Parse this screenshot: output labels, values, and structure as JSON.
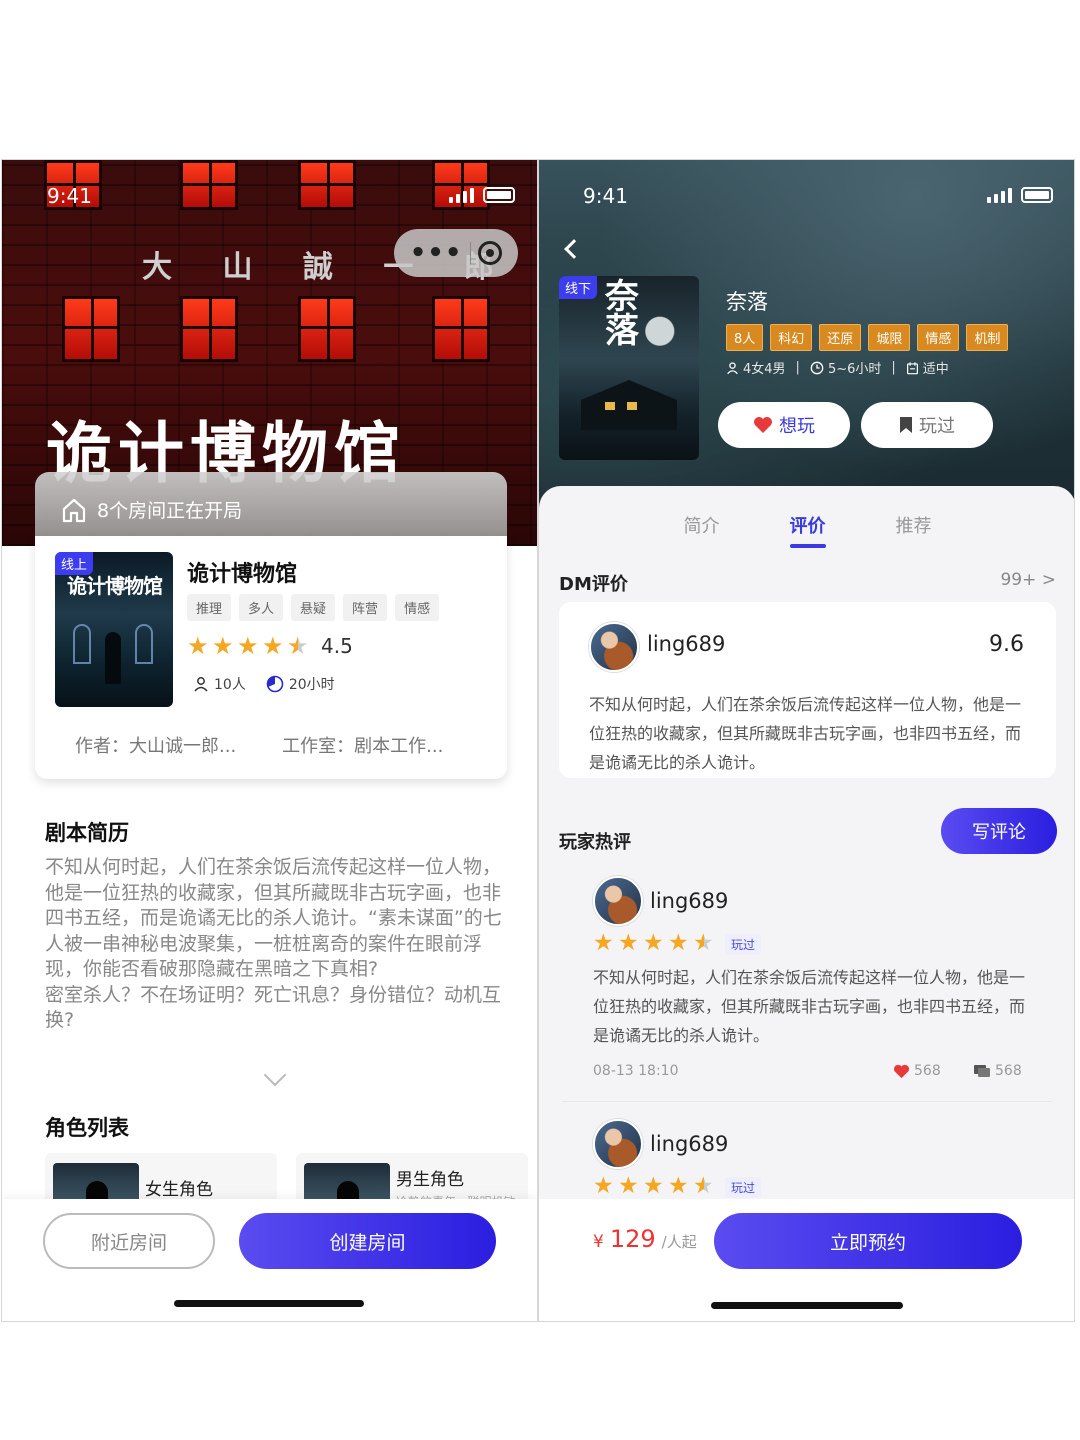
{
  "left": {
    "status": {
      "time": "9:41"
    },
    "hero": {
      "author_banner": "大 山 誠 一 郎",
      "title": "诡计博物馆"
    },
    "rooms_bar": {
      "text": "8个房间正在开局"
    },
    "game": {
      "cover_tag": "线上",
      "cover_title": "诡计博物馆",
      "name": "诡计博物馆",
      "tags": [
        "推理",
        "多人",
        "悬疑",
        "阵营",
        "情感"
      ],
      "rating": "4.5",
      "rating_value": 4.5,
      "players": "10人",
      "duration": "20小时",
      "author": "作者：大山诚一郎...",
      "studio": "工作室：剧本工作..."
    },
    "intro": {
      "title": "剧本简历",
      "text": "不知从何时起，人们在茶余饭后流传起这样一位人物，他是一位狂热的收藏家，但其所藏既非古玩字画，也非四书五经，而是诡谲无比的杀人诡计。“素未谋面”的七人被一串神秘电波聚集，一桩桩离奇的案件在眼前浮现，你能否看破那隐藏在黑暗之下真相?\n密室杀人？不在场证明？死亡讯息？身份错位？动机互换?"
    },
    "roles": {
      "title": "角色列表",
      "items": [
        {
          "label": "女生角色",
          "sub": ""
        },
        {
          "label": "男生角色",
          "sub": "冷静的青年...聪明机敏"
        }
      ]
    },
    "bottom": {
      "nearby": "附近房间",
      "create": "创建房间"
    }
  },
  "right": {
    "status": {
      "time": "9:41"
    },
    "game": {
      "cover_tag": "线下",
      "cover_title": "奈落",
      "name": "奈落",
      "tags": [
        "8人",
        "科幻",
        "还原",
        "城限",
        "情感",
        "机制"
      ],
      "cast": "4女4男",
      "duration": "5~6小时",
      "difficulty": "适中"
    },
    "actions": {
      "want": "想玩",
      "played": "玩过"
    },
    "tabs": [
      "简介",
      "评价",
      "推荐"
    ],
    "active_tab": "评价",
    "dm": {
      "title": "DM评价",
      "more": "99+ >",
      "user": "ling689",
      "score": "9.6",
      "text": "不知从何时起，人们在茶余饭后流传起这样一位人物，他是一位狂热的收藏家，但其所藏既非古玩字画，也非四书五经，而是诡谲无比的杀人诡计。"
    },
    "hot": {
      "title": "玩家热评",
      "write": "写评论",
      "reviews": [
        {
          "user": "ling689",
          "stars": 4.5,
          "tag": "玩过",
          "text": "不知从何时起，人们在茶余饭后流传起这样一位人物，他是一位狂热的收藏家，但其所藏既非古玩字画，也非四书五经，而是诡谲无比的杀人诡计。",
          "time": "08-13 18:10",
          "likes": "568",
          "comments": "568"
        },
        {
          "user": "ling689",
          "stars": 4.5,
          "tag": "玩过"
        }
      ]
    },
    "bottom": {
      "currency": "¥",
      "price": "129",
      "unit": "/人起",
      "book": "立即预约"
    }
  },
  "colors": {
    "accent": "#3a3ae0",
    "star": "#f5a623",
    "price": "#e33333",
    "tag_orange": "#d88a20"
  }
}
